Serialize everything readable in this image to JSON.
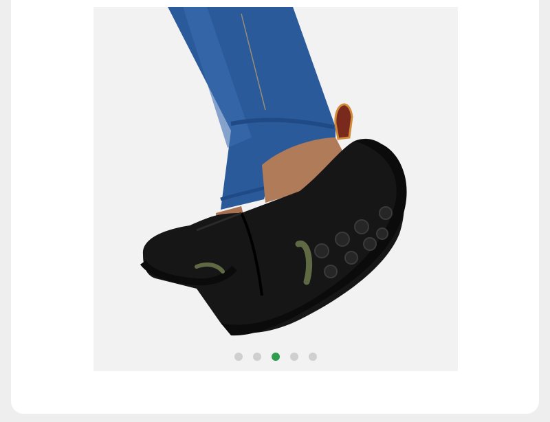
{
  "gallery": {
    "active_index": 2,
    "slide_count": 5,
    "accent_color": "#2e9d4d",
    "dot_color": "#cfcfcf",
    "image_subject": "black-suede-slip-on-shoe"
  }
}
